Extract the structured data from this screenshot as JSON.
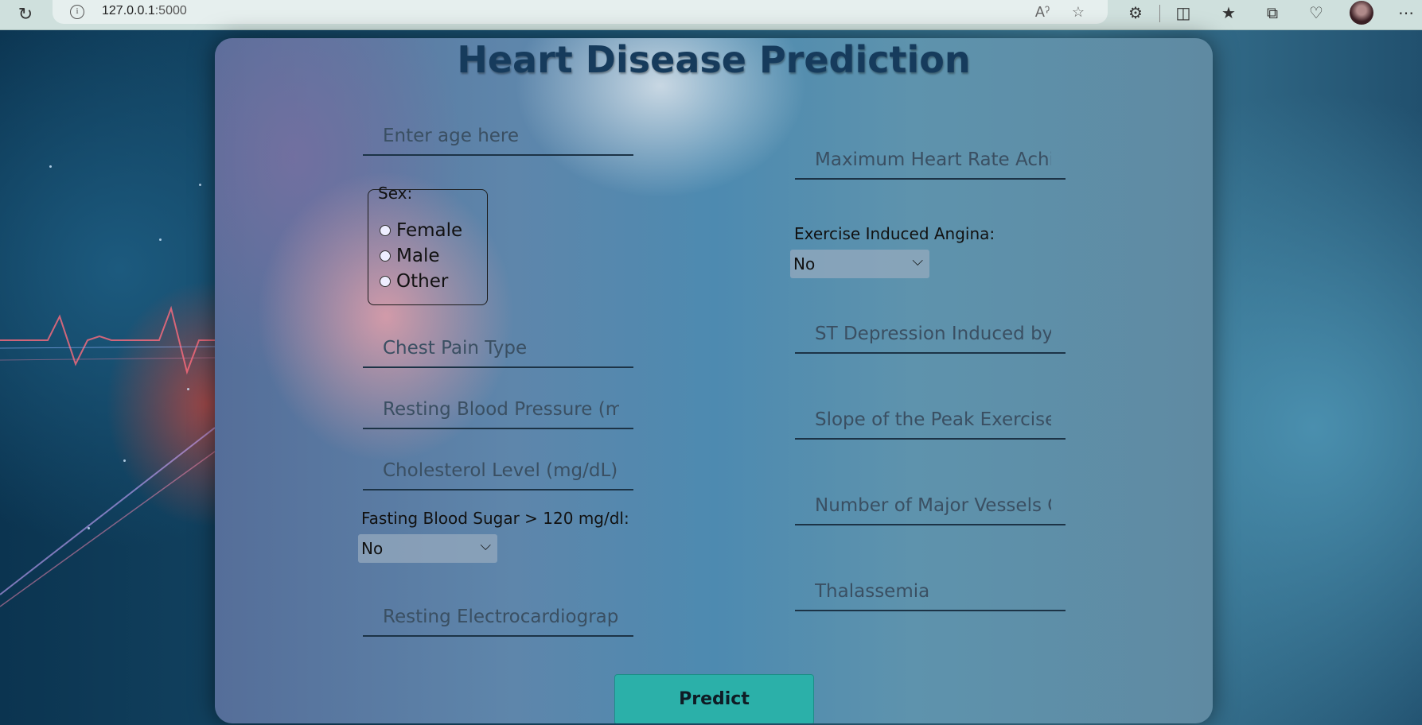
{
  "browser": {
    "url_host": "127.0.0.1",
    "url_port": ":5000"
  },
  "page": {
    "title": "Heart Disease Prediction"
  },
  "form": {
    "age_placeholder": "Enter age here",
    "sex_legend": "Sex:",
    "sex_options": [
      "Female",
      "Male",
      "Other"
    ],
    "chest_pain_placeholder": "Chest Pain Type",
    "resting_bp_placeholder": "Resting Blood Pressure (mm",
    "cholesterol_placeholder": "Cholesterol Level (mg/dL)",
    "fbs_label": "Fasting Blood Sugar > 120 mg/dl:",
    "fbs_value": "No",
    "restecg_placeholder": "Resting Electrocardiographi",
    "max_hr_placeholder": "Maximum Heart Rate Achie",
    "exang_label": "Exercise Induced Angina:",
    "exang_value": "No",
    "st_depression_placeholder": "ST Depression Induced by E",
    "slope_placeholder": "Slope of the Peak Exercise S",
    "vessels_placeholder": "Number of Major Vessels Co",
    "thal_placeholder": "Thalassemia",
    "predict_label": "Predict"
  },
  "colors": {
    "accent": "#2bb0a9",
    "title": "#163b5c"
  }
}
